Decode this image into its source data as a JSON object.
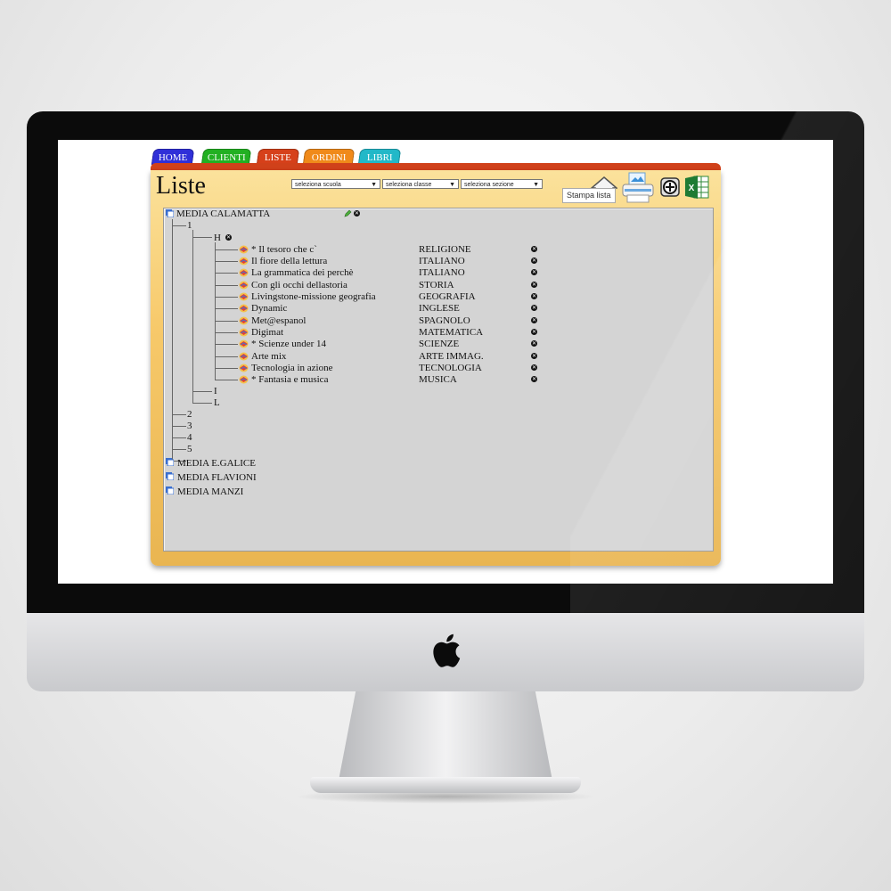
{
  "tabs": [
    {
      "label": "HOME",
      "color": "#2f2fd8"
    },
    {
      "label": "CLIENTI",
      "color": "#22b022"
    },
    {
      "label": "LISTE",
      "color": "#d6401a"
    },
    {
      "label": "ORDINI",
      "color": "#f08a1a"
    },
    {
      "label": "LIBRI",
      "color": "#22b8c8"
    }
  ],
  "page_title": "Liste",
  "filters": {
    "scuola": "seleziona scuola",
    "classe": "seleziona classe",
    "sezione": "seleziona sezione"
  },
  "toolbar": {
    "icons": [
      "home-icon",
      "printer-icon",
      "add-icon",
      "excel-icon"
    ],
    "tooltip": "Stampa lista"
  },
  "tree": {
    "school_open": "MEDIA CALAMATTA",
    "classes": [
      "1",
      "2",
      "3",
      "4",
      "5"
    ],
    "sections": [
      "H",
      "I",
      "L"
    ],
    "books": [
      {
        "title": "* Il tesoro che c`",
        "subject": "RELIGIONE"
      },
      {
        "title": "Il fiore della lettura",
        "subject": "ITALIANO"
      },
      {
        "title": "La grammatica dei perchè",
        "subject": "ITALIANO"
      },
      {
        "title": "Con gli occhi dellastoria",
        "subject": "STORIA"
      },
      {
        "title": "Livingstone-missione geografia",
        "subject": "GEOGRAFIA"
      },
      {
        "title": "Dynamic",
        "subject": "INGLESE"
      },
      {
        "title": "Met@espanol",
        "subject": "SPAGNOLO"
      },
      {
        "title": "Digimat",
        "subject": "MATEMATICA"
      },
      {
        "title": "* Scienze under 14",
        "subject": "SCIENZE"
      },
      {
        "title": "Arte mix",
        "subject": "ARTE IMMAG."
      },
      {
        "title": "Tecnologia in azione",
        "subject": "TECNOLOGIA"
      },
      {
        "title": "* Fantasia e musica",
        "subject": "MUSICA"
      }
    ],
    "other_schools": [
      "MEDIA E.GALICE",
      "MEDIA FLAVIONI",
      "MEDIA MANZI"
    ]
  }
}
